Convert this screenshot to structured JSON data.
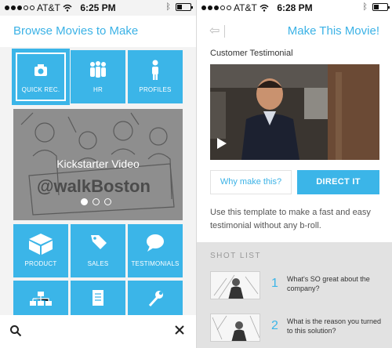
{
  "left_screen": {
    "status": {
      "carrier": "AT&T",
      "time": "6:25 PM"
    },
    "nav": {
      "title": "Browse Movies to Make"
    },
    "top_tiles": [
      {
        "label": "QUICK REC.",
        "icon": "camera-icon",
        "selected": true
      },
      {
        "label": "HR",
        "icon": "people-group-icon"
      },
      {
        "label": "PROFILES",
        "icon": "person-icon"
      }
    ],
    "hero": {
      "title": "Kickstarter Video",
      "page": 1,
      "pages": 3
    },
    "bottom_tiles": [
      {
        "label": "PRODUCT",
        "icon": "box-icon"
      },
      {
        "label": "SALES",
        "icon": "tag-icon"
      },
      {
        "label": "TESTIMONIALS",
        "icon": "speech-bubble-icon"
      }
    ],
    "partial_tiles": [
      {
        "icon": "org-chart-icon"
      },
      {
        "icon": "document-icon"
      },
      {
        "icon": "wrench-icon"
      }
    ],
    "search_bar": {
      "search_icon": "search-icon",
      "close_icon": "close-icon"
    }
  },
  "right_screen": {
    "status": {
      "carrier": "AT&T",
      "time": "6:28 PM"
    },
    "nav": {
      "back_icon": "back-arrow-icon",
      "title": "Make This Movie!"
    },
    "section_heading": "Customer Testimonial",
    "buttons": {
      "why": "Why make this?",
      "direct": "DIRECT IT"
    },
    "description": "Use this template to make a fast and easy testimonial without any b-roll.",
    "shot_list": {
      "heading": "SHOT LIST",
      "items": [
        {
          "number": "1",
          "text": "What's SO great about the company?"
        },
        {
          "number": "2",
          "text": "What is the reason you turned to this solution?"
        }
      ]
    }
  },
  "colors": {
    "accent": "#3bb5e8",
    "background": "#f3f3f3",
    "shot_list_bg": "#e2e2e2"
  }
}
